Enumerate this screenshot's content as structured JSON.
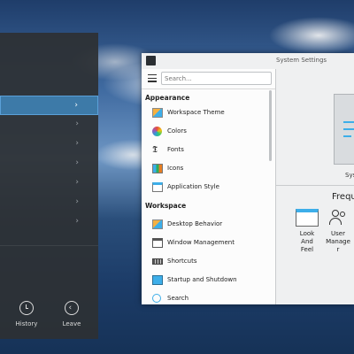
{
  "launcher": {
    "bottom_buttons": [
      {
        "label": "History",
        "icon": "history-icon"
      },
      {
        "label": "Leave",
        "icon": "leave-icon"
      }
    ],
    "chevron": "›"
  },
  "window": {
    "title": "System Settings",
    "search": {
      "placeholder": "Search..."
    },
    "categories": [
      {
        "header": "Appearance",
        "items": [
          {
            "label": "Workspace Theme",
            "icon": "workspace-theme-icon"
          },
          {
            "label": "Colors",
            "icon": "colors-icon"
          },
          {
            "label": "Fonts",
            "icon": "fonts-icon"
          },
          {
            "label": "Icons",
            "icon": "icons-icon"
          },
          {
            "label": "Application Style",
            "icon": "application-style-icon"
          }
        ]
      },
      {
        "header": "Workspace",
        "items": [
          {
            "label": "Desktop Behavior",
            "icon": "desktop-behavior-icon"
          },
          {
            "label": "Window Management",
            "icon": "window-management-icon"
          },
          {
            "label": "Shortcuts",
            "icon": "shortcuts-icon"
          },
          {
            "label": "Startup and Shutdown",
            "icon": "startup-shutdown-icon"
          },
          {
            "label": "Search",
            "icon": "search-icon"
          }
        ]
      }
    ],
    "right": {
      "system_label": "Syst",
      "frequent_label": "Freque",
      "tiles": [
        {
          "label": "Look And Feel",
          "icon": "look-and-feel-icon"
        },
        {
          "label": "User Manage r",
          "icon": "user-manager-icon"
        }
      ]
    }
  },
  "colors": {
    "accent": "#3daee9",
    "selection": "#3d7aa8"
  }
}
